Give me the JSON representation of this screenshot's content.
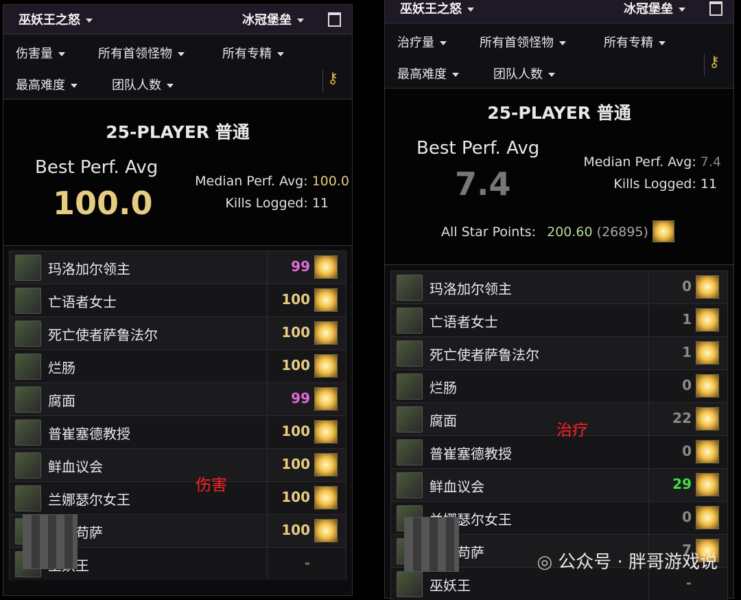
{
  "left": {
    "zone": "巫妖王之怒",
    "instance": "冰冠堡垒",
    "metric": "伤害量",
    "bosses_filter": "所有首领怪物",
    "spec_filter": "所有专精",
    "difficulty_filter": "最高难度",
    "size_filter": "团队人数",
    "difficulty_label": "25-PLAYER 普通",
    "best_perf_label": "Best Perf. Avg",
    "best_perf_value": "100.0",
    "median_label": "Median Perf. Avg:",
    "median_value": "100.0",
    "kills_label": "Kills Logged:",
    "kills_value": "11",
    "overlay_text": "伤害",
    "rows": [
      {
        "name": "玛洛加尔领主",
        "score": "99",
        "color": "#e06ad8"
      },
      {
        "name": "亡语者女士",
        "score": "100",
        "color": "#e5cc80"
      },
      {
        "name": "死亡使者萨鲁法尔",
        "score": "100",
        "color": "#e5cc80"
      },
      {
        "name": "烂肠",
        "score": "100",
        "color": "#e5cc80"
      },
      {
        "name": "腐面",
        "score": "99",
        "color": "#e06ad8"
      },
      {
        "name": "普崔塞德教授",
        "score": "100",
        "color": "#e5cc80"
      },
      {
        "name": "鲜血议会",
        "score": "100",
        "color": "#e5cc80"
      },
      {
        "name": "兰娜瑟尔女王",
        "score": "100",
        "color": "#e5cc80"
      },
      {
        "name": "辛达苟萨",
        "score": "100",
        "color": "#e5cc80"
      },
      {
        "name": "巫妖王",
        "score": "-",
        "color": "#777777"
      }
    ]
  },
  "right": {
    "zone": "巫妖王之怒",
    "instance": "冰冠堡垒",
    "metric": "治疗量",
    "bosses_filter": "所有首领怪物",
    "spec_filter": "所有专精",
    "difficulty_filter": "最高难度",
    "size_filter": "团队人数",
    "difficulty_label": "25-PLAYER 普通",
    "best_perf_label": "Best Perf. Avg",
    "best_perf_value": "7.4",
    "median_label": "Median Perf. Avg:",
    "median_value": "7.4",
    "kills_label": "Kills Logged:",
    "kills_value": "11",
    "star_label": "All Star Points:",
    "star_points": "200.60",
    "star_rank": "(26895)",
    "overlay_text": "治疗",
    "rows": [
      {
        "name": "玛洛加尔领主",
        "score": "0",
        "color": "#8a8a8a"
      },
      {
        "name": "亡语者女士",
        "score": "1",
        "color": "#8a8a8a"
      },
      {
        "name": "死亡使者萨鲁法尔",
        "score": "1",
        "color": "#8a8a8a"
      },
      {
        "name": "烂肠",
        "score": "0",
        "color": "#8a8a8a"
      },
      {
        "name": "腐面",
        "score": "22",
        "color": "#8a8a8a"
      },
      {
        "name": "普崔塞德教授",
        "score": "0",
        "color": "#8a8a8a"
      },
      {
        "name": "鲜血议会",
        "score": "29",
        "color": "#3ee03e"
      },
      {
        "name": "兰娜瑟尔女王",
        "score": "0",
        "color": "#8a8a8a"
      },
      {
        "name": "辛达苟萨",
        "score": "7",
        "color": "#8a8a8a"
      },
      {
        "name": "巫妖王",
        "score": "-",
        "color": "#777777"
      }
    ]
  },
  "watermark": "公众号 · 胖哥游戏说"
}
